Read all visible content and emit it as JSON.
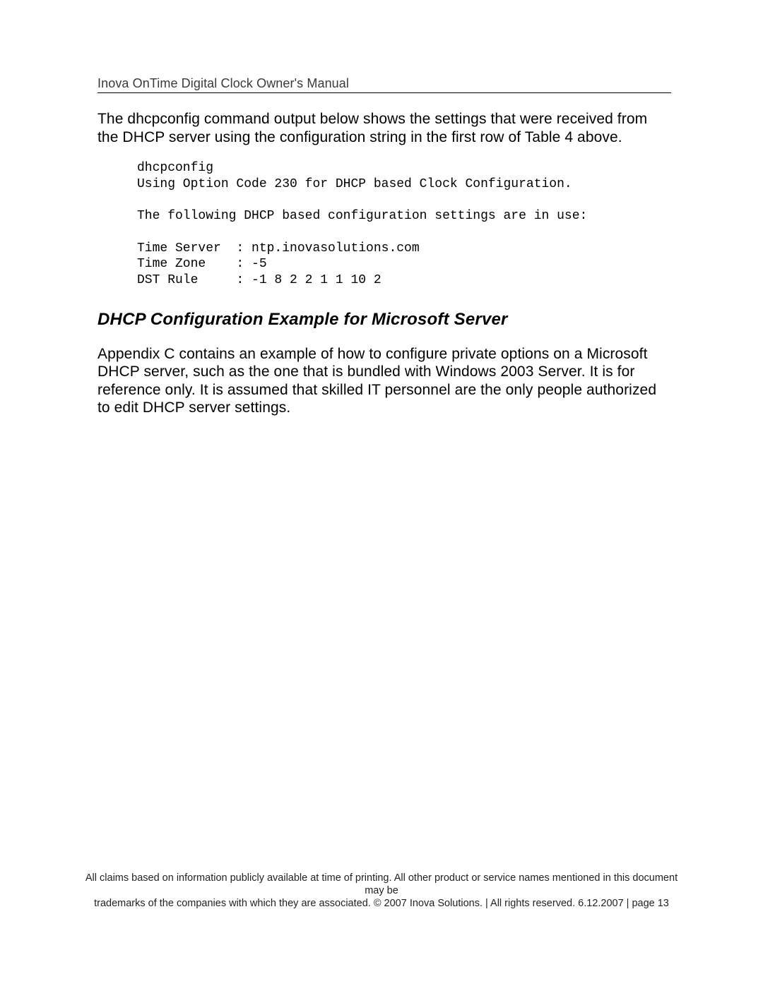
{
  "header": {
    "running_head": "Inova OnTime Digital Clock Owner's Manual"
  },
  "content": {
    "intro_para": "The dhcpconfig command output below shows the settings that were received from the DHCP server using the configuration string in the first row of Table 4 above.",
    "code_block": "dhcpconfig\nUsing Option Code 230 for DHCP based Clock Configuration.\n\nThe following DHCP based configuration settings are in use:\n\nTime Server  : ntp.inovasolutions.com\nTime Zone    : -5\nDST Rule     : -1 8 2 2 1 1 10 2",
    "section_heading": "DHCP Configuration Example for Microsoft Server",
    "section_para": "Appendix C contains an example of how to configure private options on a Microsoft DHCP server, such as the one that is bundled with Windows 2003 Server.  It is for reference only.  It is assumed that skilled IT personnel are the only people authorized to edit DHCP server settings."
  },
  "footer": {
    "line1": "All claims based on information publicly available at time of printing. All other product or service names mentioned in this document may be",
    "line2": "trademarks of the companies with which they are associated. © 2007 Inova Solutions.  |  All rights reserved. 6.12.2007  |  page 13"
  }
}
